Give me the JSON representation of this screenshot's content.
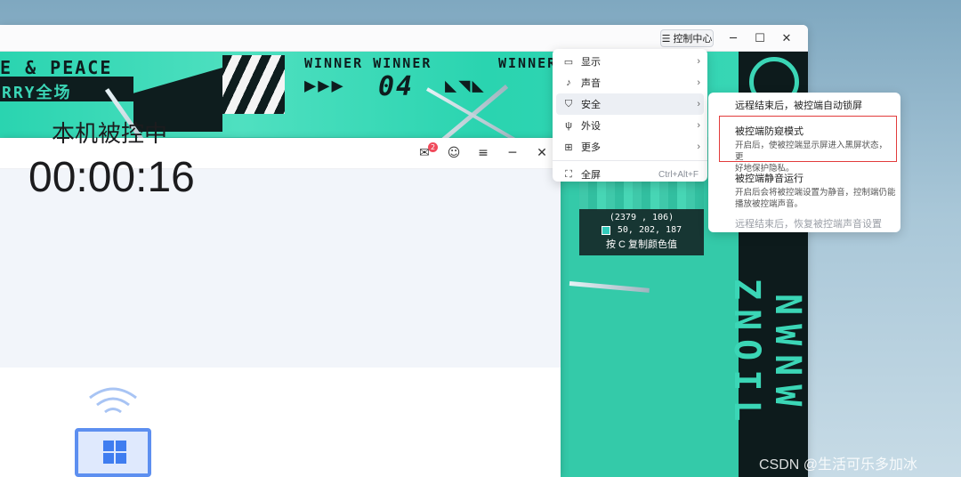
{
  "outer_window": {
    "control_center_label": "控制中心",
    "minimize_icon": "minimize-icon",
    "maximize_icon": "maximize-icon",
    "close_icon": "close-icon"
  },
  "wallpaper": {
    "banner_left_top": "E & PEACE",
    "banner_left_bottom": "RRY全场",
    "banner_mid_top": "WINNER WINNER",
    "banner_mid_bottom": "04",
    "banner_right": "WINNER",
    "vertical_text": "NWNW ZNOIL",
    "accent_color": "#34caa9"
  },
  "color_picker": {
    "coords": "(2379 , 106)",
    "rgb": "50, 202, 187",
    "swatch_color": "#32cabb",
    "hint": "按 C 复制颜色值"
  },
  "client_window": {
    "mail_badge": "2",
    "status_label": "本机被控中",
    "timer": "00:00:16"
  },
  "menu": {
    "items": [
      {
        "label": "显示",
        "icon": "monitor-icon",
        "glyph": "▭"
      },
      {
        "label": "声音",
        "icon": "speaker-icon",
        "glyph": "♪"
      },
      {
        "label": "安全",
        "icon": "shield-icon",
        "glyph": "⛉"
      },
      {
        "label": "外设",
        "icon": "usb-icon",
        "glyph": "ψ"
      },
      {
        "label": "更多",
        "icon": "grid-icon",
        "glyph": "⊞"
      }
    ],
    "fullscreen": {
      "label": "全屏",
      "shortcut": "Ctrl+Alt+F",
      "icon": "fullscreen-icon"
    }
  },
  "submenu": {
    "item1_title": "远程结束后，被控端自动锁屏",
    "item2_title": "被控端防窥模式",
    "item2_desc_1": "开启后，使被控端显示屏进入黑屏状态，更",
    "item2_desc_2": "好地保护隐私。",
    "item3_title": "被控端静音运行",
    "item3_desc_1": "开启后会将被控端设置为静音，控制端仍能",
    "item3_desc_2": "播放被控端声音。",
    "item4_title": "远程结束后，恢复被控端声音设置"
  },
  "watermark": "CSDN @生活可乐多加冰"
}
